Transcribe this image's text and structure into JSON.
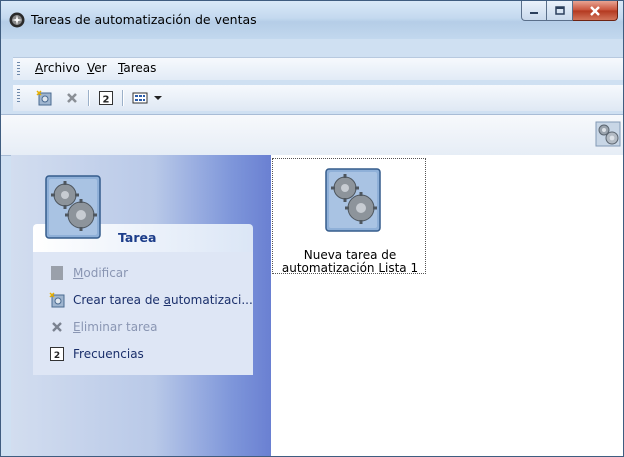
{
  "window": {
    "title": "Tareas de automatización de ventas",
    "accent": "#3f5d80"
  },
  "menu": {
    "items": [
      {
        "underline": "A",
        "rest": "rchivo"
      },
      {
        "underline": "V",
        "rest": "er"
      },
      {
        "underline": "T",
        "rest": "areas"
      }
    ]
  },
  "toolbar": {
    "icons": [
      "new-task-icon",
      "delete-icon",
      "refresh-icon",
      "view-icon",
      "dropdown-arrow-icon"
    ]
  },
  "task_panel": {
    "header": "Tarea",
    "items": [
      {
        "u_pre": "",
        "u": "M",
        "post": "odificar",
        "enabled": false,
        "icon": "modify-icon"
      },
      {
        "u_pre": "Crear tarea de ",
        "u": "a",
        "post": "utomatizaci...",
        "enabled": true,
        "icon": "create-task-icon"
      },
      {
        "u_pre": "",
        "u": "E",
        "post": "liminar tarea",
        "enabled": false,
        "icon": "delete-icon"
      },
      {
        "u_pre": "Frecuencias",
        "u": "",
        "post": "",
        "enabled": true,
        "icon": "frequency-icon"
      }
    ]
  },
  "content": {
    "items": [
      {
        "caption_line1": "Nueva tarea de",
        "caption_line2": "automatización Lista 1"
      }
    ]
  }
}
